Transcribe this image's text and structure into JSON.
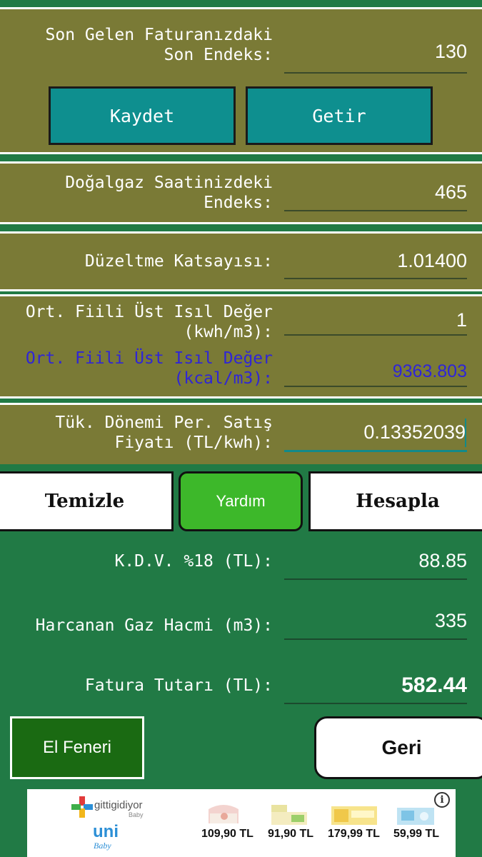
{
  "form": {
    "last_index_label": "Son Gelen Faturanızdaki\nSon Endeks:",
    "last_index_value": "130",
    "save_label": "Kaydet",
    "fetch_label": "Getir",
    "meter_index_label": "Doğalgaz Saatinizdeki\nEndeks:",
    "meter_index_value": "465",
    "correction_label": "Düzeltme Katsayısı:",
    "correction_value": "1.01400",
    "calorific_kwh_label": "Ort. Fiili Üst Isıl Değer\n(kwh/m3):",
    "calorific_kwh_value": "1",
    "calorific_kcal_label": "Ort. Fiili Üst Isıl Değer\n(kcal/m3):",
    "calorific_kcal_value": "9363.803",
    "price_label": "Tük. Dönemi Per. Satış\nFiyatı (TL/kwh):",
    "price_value": "0.13352039"
  },
  "actions": {
    "clear_label": "Temizle",
    "help_label": "Yardım",
    "calculate_label": "Hesapla"
  },
  "results": {
    "vat_label": "K.D.V. %18 (TL):",
    "vat_value": "88.85",
    "volume_label": "Harcanan Gaz Hacmi (m3):",
    "volume_value": "335",
    "total_label": "Fatura Tutarı (TL):",
    "total_value": "582.44"
  },
  "bottom": {
    "flashlight_label": "El Feneri",
    "back_label": "Geri"
  },
  "ad": {
    "brand": "gittigidiyor",
    "brand_sub": "Baby",
    "logo2": "uni",
    "logo2_sub": "Baby",
    "prices": [
      "109,90 TL",
      "91,90 TL",
      "179,99 TL",
      "59,99 TL"
    ],
    "info_symbol": "i"
  },
  "colors": {
    "olive": "#7a7a36",
    "green_bg": "#217a45",
    "teal": "#0e8f8f",
    "help_green": "#3db82a",
    "kcal_blue": "#2f25d6"
  }
}
